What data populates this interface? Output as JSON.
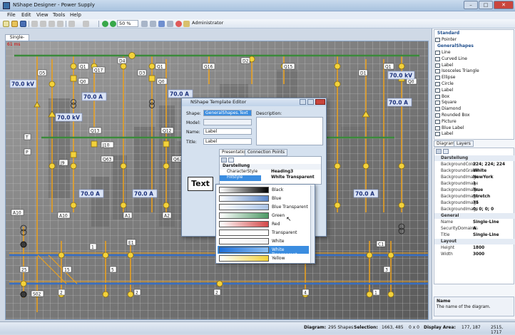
{
  "window": {
    "title": "NShape Designer - Power Supply",
    "min": "–",
    "max": "□",
    "close": "✕"
  },
  "menu": [
    "File",
    "Edit",
    "View",
    "Tools",
    "Help"
  ],
  "toolbar": {
    "zoom": "50 %",
    "user": "Administrator"
  },
  "doc_tab": "Single-Line",
  "canvas": {
    "timing": "61 ms",
    "labels": {
      "D4": "D4",
      "D2": "D2",
      "D5": "D5",
      "D3": "D3",
      "D1": "D1",
      "Q1a": "Q1",
      "Q1b": "Q1",
      "Q1c": "Q1",
      "Q17": "Q17",
      "Q16": "Q16",
      "Q15": "Q15",
      "Q0a": "Q0",
      "Q0b": "Q0",
      "Q0c": "Q0",
      "Q13": "Q13",
      "Q12": "Q12",
      "J10": "J10",
      "Q63": "Q63",
      "Q62": "Q62",
      "J9": "J9",
      "T": "T",
      "P": "P",
      "A10a": "A10",
      "A10b": "A10",
      "A1": "A1",
      "A2": "A2",
      "E1": "E1",
      "C1": "C1",
      "n25": "25",
      "n15": "15",
      "n5": "5",
      "n1a": "1",
      "n1b": "1",
      "n3": "3",
      "n4": "4",
      "n2a": "2",
      "n2b": "2",
      "n2c": "2",
      "S02": "S02"
    },
    "kv": "70.0 kV",
    "amp": "70.0 A"
  },
  "dialog": {
    "title": "NShape Template Editor",
    "shape_label": "Shape:",
    "shape_value": "GeneralShapes.Text",
    "model_label": "Model:",
    "name_label": "Name:",
    "name_value": "Label",
    "title_label": "Title:",
    "title_value": "Label",
    "description_label": "Description:",
    "preview_text": "Text",
    "tabs": [
      "Presentation",
      "Connection Points"
    ],
    "grid": {
      "category": "Darstellung",
      "rows": [
        {
          "k": "CharacterStyle",
          "v": "Heading3"
        },
        {
          "k": "FillStyle",
          "v": "White Transparent"
        }
      ]
    }
  },
  "fill_options": [
    {
      "label": "Black",
      "from": "#ffffff",
      "to": "#000000"
    },
    {
      "label": "Blue",
      "from": "#ffffff",
      "to": "#5a86c8"
    },
    {
      "label": "Blue Transparent",
      "from": "#ffffff",
      "to": "#a9c3e6"
    },
    {
      "label": "Green",
      "from": "#ffffff",
      "to": "#4e9a66"
    },
    {
      "label": "Red",
      "from": "#ffffff",
      "to": "#d44a4a"
    },
    {
      "label": "Transparent",
      "from": "#ffffff",
      "to": "#ffffff"
    },
    {
      "label": "White",
      "from": "#ffffff",
      "to": "#f4f4f4"
    },
    {
      "label": "White Transparent",
      "from": "#1e6fd9",
      "to": "#8ec0f2"
    },
    {
      "label": "Yellow",
      "from": "#ffffff",
      "to": "#f2d23b"
    }
  ],
  "toolbox": {
    "cat_standard": "Standard",
    "standard": [
      "Pointer"
    ],
    "cat_general": "GeneralShapes",
    "general": [
      "Line",
      "Curved Line",
      "Label",
      "Isosceles Triangle",
      "Ellipse",
      "Circle",
      "Label",
      "Box",
      "Square",
      "Diamond",
      "Rounded Box",
      "Picture",
      "Blue Label",
      "Label"
    ]
  },
  "props": {
    "tabs": [
      "Diagram",
      "Layers"
    ],
    "rows": [
      {
        "k": "Darstellung",
        "v": "",
        "cat": true
      },
      {
        "k": "BackgroundColor",
        "v": "224; 224; 224"
      },
      {
        "k": "BackgroundGradient",
        "v": "White"
      },
      {
        "k": "BackgroundImage",
        "v": "NewYork"
      },
      {
        "k": "BackgroundImage",
        "v": "1"
      },
      {
        "k": "BackgroundImage",
        "v": "True"
      },
      {
        "k": "BackgroundImage",
        "v": "Stretch"
      },
      {
        "k": "BackgroundImage",
        "v": "75"
      },
      {
        "k": "BackgroundImage",
        "v": "0; 0; 0; 0"
      },
      {
        "k": "General",
        "v": "",
        "cat": true
      },
      {
        "k": "Name",
        "v": "Single-Line"
      },
      {
        "k": "SecurityDomainName",
        "v": "A"
      },
      {
        "k": "Title",
        "v": "Single-Line"
      },
      {
        "k": "Layout",
        "v": "",
        "cat": true
      },
      {
        "k": "Height",
        "v": "1800"
      },
      {
        "k": "Width",
        "v": "3000"
      }
    ],
    "desc_title": "Name",
    "desc_text": "The name of the diagram."
  },
  "status": {
    "diagram_label": "Diagram:",
    "diagram_value": "295 Shapes",
    "selection_label": "Selection:",
    "selection_value": "1663, 485",
    "selection_size": "0 x 0",
    "display_label": "Display Area:",
    "display_origin": "177, 187",
    "display_size": "2515, 1717"
  }
}
